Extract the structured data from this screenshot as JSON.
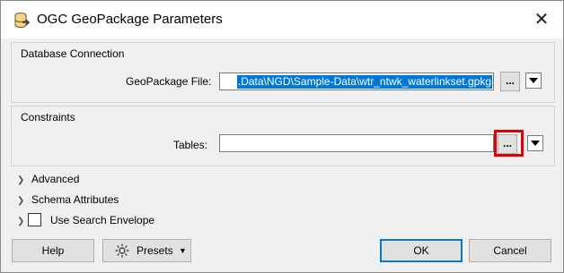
{
  "window": {
    "title": "OGC GeoPackage Parameters",
    "close_glyph": "✕"
  },
  "database_connection": {
    "group_title": "Database Connection",
    "file_label": "GeoPackage File:",
    "file_value": ".Data\\NGD\\Sample-Data\\wtr_ntwk_waterlinkset.gpkg",
    "browse_label": "..."
  },
  "constraints": {
    "group_title": "Constraints",
    "tables_label": "Tables:",
    "tables_value": "",
    "browse_label": "..."
  },
  "sections": {
    "advanced": "Advanced",
    "schema_attributes": "Schema Attributes",
    "use_search_envelope": "Use Search Envelope",
    "use_search_envelope_checked": false
  },
  "buttons": {
    "help": "Help",
    "presets": "Presets",
    "ok": "OK",
    "cancel": "Cancel"
  },
  "colors": {
    "selection": "#0078d7",
    "highlight": "#e00000"
  }
}
